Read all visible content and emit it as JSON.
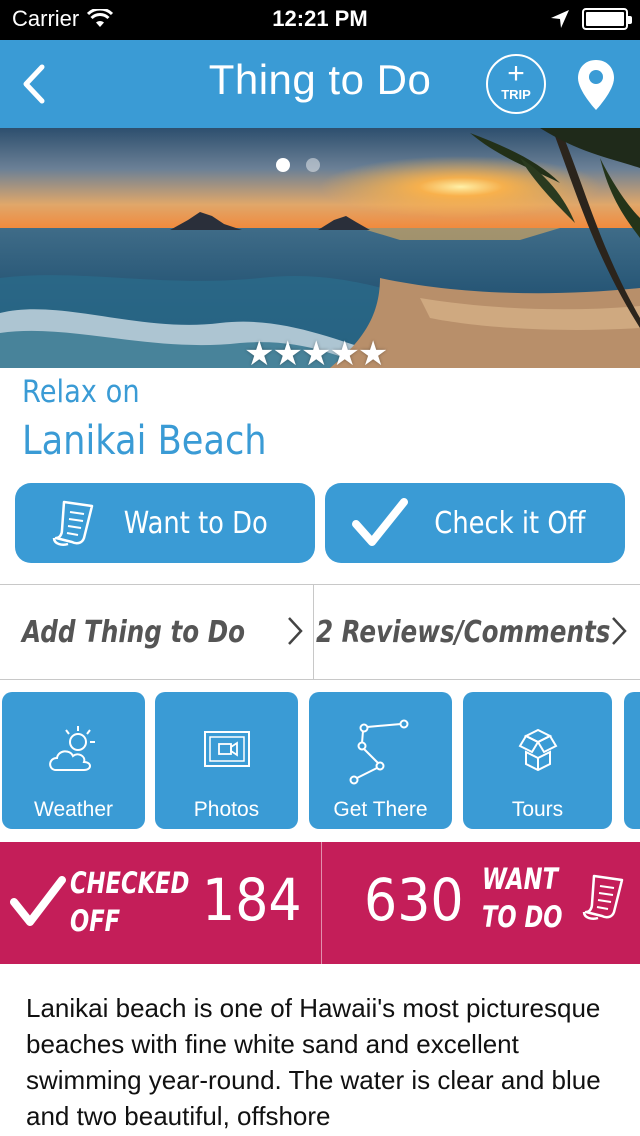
{
  "status_bar": {
    "carrier": "Carrier",
    "time": "12:21 PM"
  },
  "nav": {
    "title": "Thing to Do",
    "trip_label": "TRIP",
    "trip_plus": "+"
  },
  "hero": {
    "rating_stars": 5,
    "stars_text": "★★★★★",
    "page_count": 2,
    "active_page": 1
  },
  "place": {
    "pre_title": "Relax on",
    "title": "Lanikai Beach"
  },
  "actions": {
    "want_label": "Want to Do",
    "check_label": "Check it Off"
  },
  "links": {
    "add_label": "Add Thing to Do",
    "reviews_label": "2 Reviews/Comments"
  },
  "tiles": [
    {
      "label": "Weather",
      "icon": "weather-icon"
    },
    {
      "label": "Photos",
      "icon": "photos-icon"
    },
    {
      "label": "Get There",
      "icon": "route-icon"
    },
    {
      "label": "Tours",
      "icon": "tours-icon"
    }
  ],
  "counters": {
    "checked_line1": "CHECKED",
    "checked_line2": "OFF",
    "checked_count": "184",
    "want_count": "630",
    "want_line1": "WANT",
    "want_line2": "TO DO"
  },
  "description": "Lanikai beach is one of Hawaii's most picturesque beaches with fine white sand and excellent swimming year-round. The water is clear and blue and two beautiful, offshore",
  "colors": {
    "primary_blue": "#3a9bd5",
    "counter_red": "#c41e59"
  }
}
